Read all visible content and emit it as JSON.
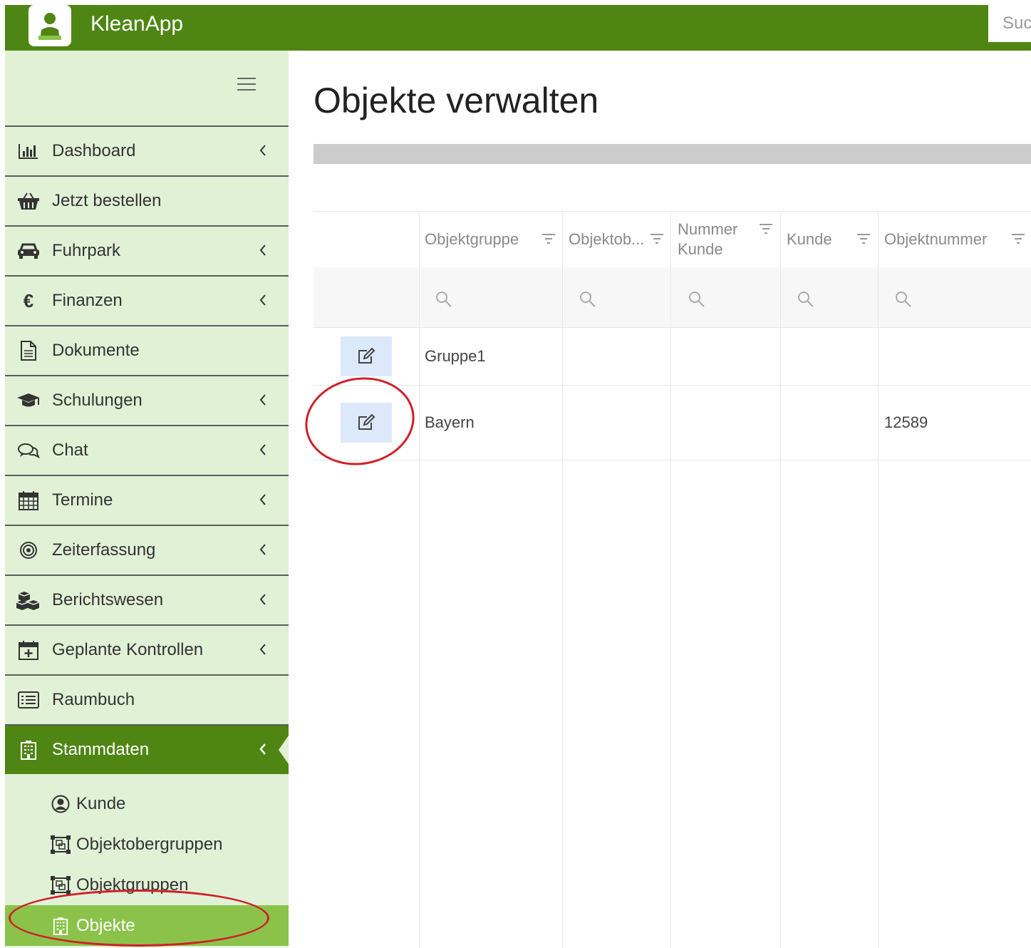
{
  "app": {
    "title": "KleanApp",
    "search_placeholder": "Suc"
  },
  "sidebar": {
    "items": [
      {
        "label": "Dashboard",
        "icon": "bar-chart-icon",
        "has_chevron": true
      },
      {
        "label": "Jetzt bestellen",
        "icon": "basket-icon",
        "has_chevron": false
      },
      {
        "label": "Fuhrpark",
        "icon": "car-icon",
        "has_chevron": true
      },
      {
        "label": "Finanzen",
        "icon": "euro-icon",
        "has_chevron": true
      },
      {
        "label": "Dokumente",
        "icon": "document-icon",
        "has_chevron": false
      },
      {
        "label": "Schulungen",
        "icon": "graduation-cap-icon",
        "has_chevron": true
      },
      {
        "label": "Chat",
        "icon": "chat-bubbles-icon",
        "has_chevron": true
      },
      {
        "label": "Termine",
        "icon": "calendar-icon",
        "has_chevron": true
      },
      {
        "label": "Zeiterfassung",
        "icon": "target-icon",
        "has_chevron": true
      },
      {
        "label": "Berichtswesen",
        "icon": "cubes-icon",
        "has_chevron": true
      },
      {
        "label": "Geplante Kontrollen",
        "icon": "calendar-plus-icon",
        "has_chevron": true
      },
      {
        "label": "Raumbuch",
        "icon": "list-alt-icon",
        "has_chevron": false
      },
      {
        "label": "Stammdaten",
        "icon": "building-icon",
        "has_chevron": true,
        "active": true
      }
    ],
    "sub_items": [
      {
        "label": "Kunde",
        "icon": "user-circle-icon"
      },
      {
        "label": "Objektobergruppen",
        "icon": "object-group-icon"
      },
      {
        "label": "Objektgruppen",
        "icon": "object-group-icon"
      },
      {
        "label": "Objekte",
        "icon": "building-icon",
        "active": true
      }
    ]
  },
  "main": {
    "title": "Objekte verwalten",
    "columns": [
      {
        "label": "Objektgruppe"
      },
      {
        "label": "Objektob..."
      },
      {
        "label_line1": "Nummer",
        "label_line2": "Kunde"
      },
      {
        "label": "Kunde"
      },
      {
        "label": "Objektnummer"
      }
    ],
    "rows": [
      {
        "objektgruppe": "Gruppe1",
        "objektobergruppe": "",
        "nummer_kunde": "",
        "kunde": "",
        "objektnummer": ""
      },
      {
        "objektgruppe": "Bayern",
        "objektobergruppe": "",
        "nummer_kunde": "",
        "kunde": "",
        "objektnummer": "12589"
      }
    ]
  },
  "colors": {
    "header_green": "#4f8613",
    "sidebar_bg": "#e1f1d6",
    "active_sub": "#8bc34a",
    "highlight_red": "#d0202a",
    "edit_button_bg": "#dce9fb"
  }
}
